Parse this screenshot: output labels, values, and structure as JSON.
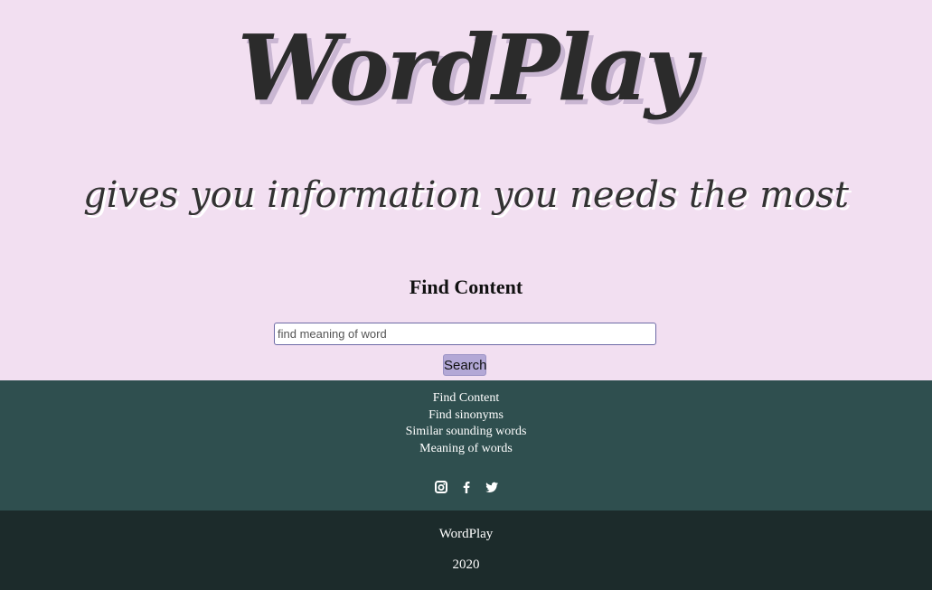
{
  "hero": {
    "brand": "WordPlay",
    "tagline": "gives you information you needs the most"
  },
  "search": {
    "title": "Find Content",
    "placeholder": "find meaning of word",
    "button_label": "Search"
  },
  "footer_links": [
    "Find Content",
    "Find sinonyms",
    "Similar sounding words",
    "Meaning of words"
  ],
  "social_icons": [
    "instagram-icon",
    "facebook-icon",
    "twitter-icon"
  ],
  "footer": {
    "brand": "WordPlay",
    "year": "2020"
  },
  "colors": {
    "hero_background": "#f2dff1",
    "links_background": "#2f4f4f",
    "bottom_background": "#1c2b2b",
    "button_background": "#b3a8d6"
  }
}
